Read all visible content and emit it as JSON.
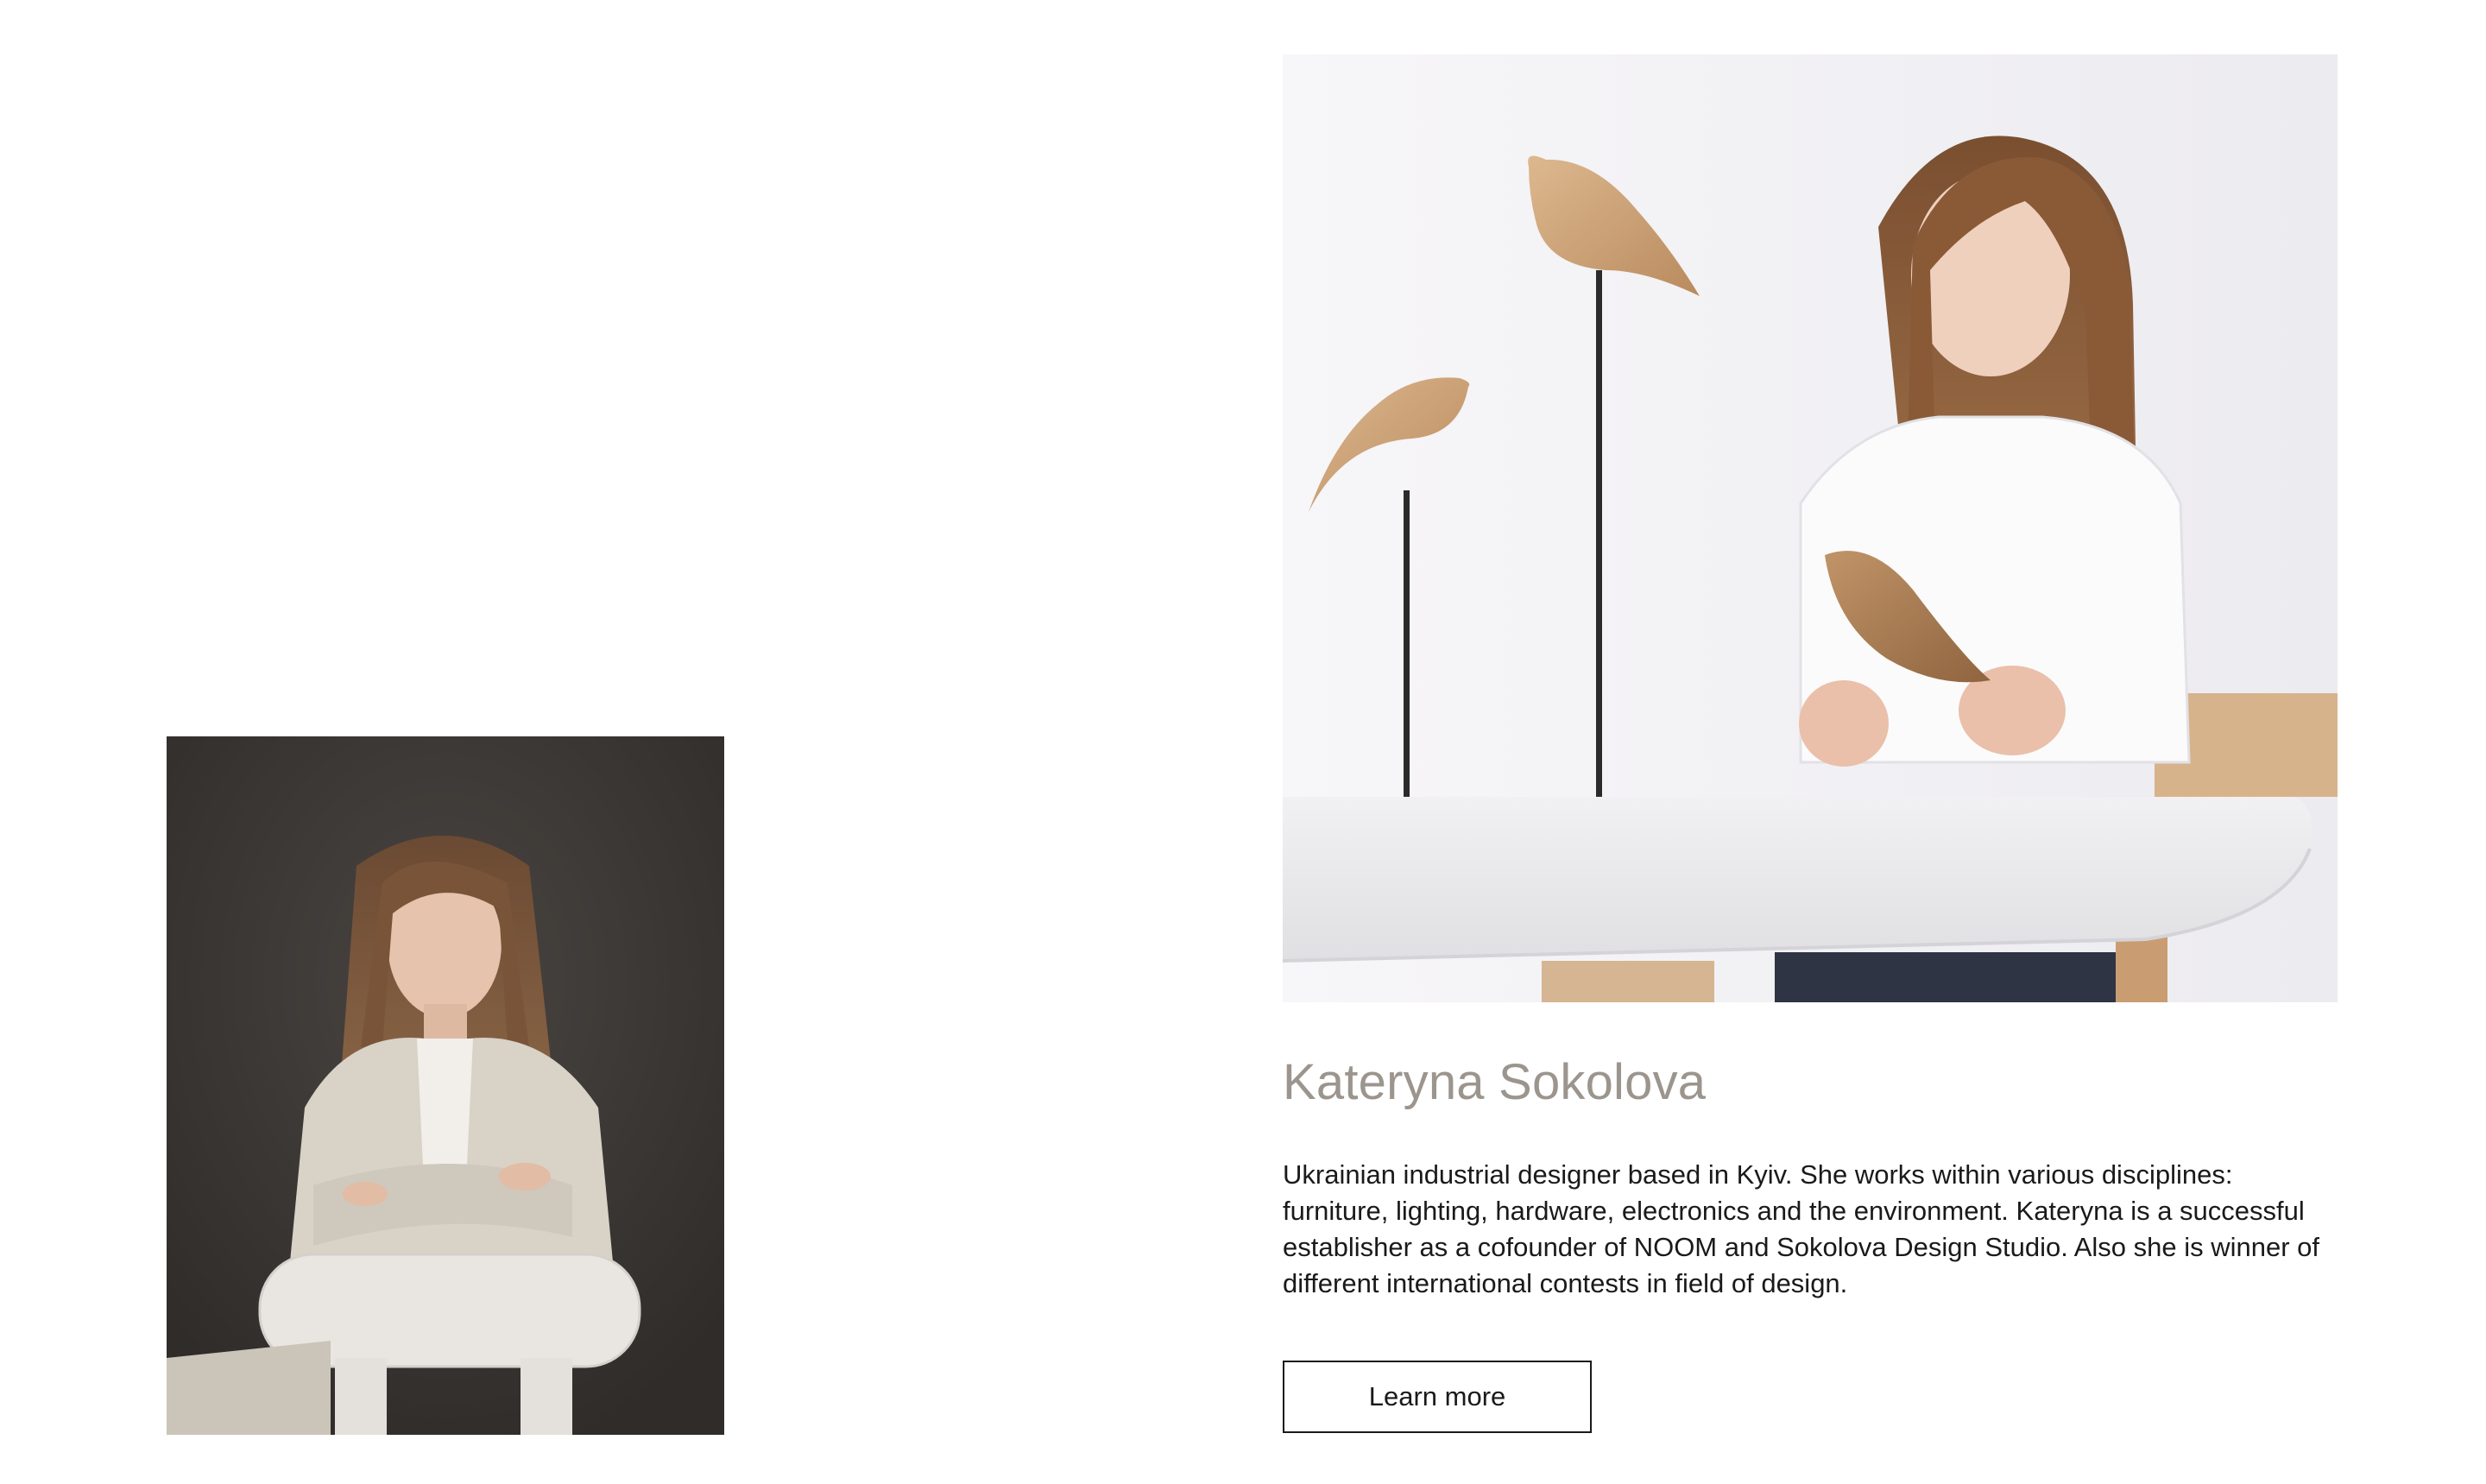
{
  "designer": {
    "name": "Kateryna Sokolova",
    "bio": "Ukrainian industrial designer based in Kyiv. She works within various disciplines: furniture, lighting, hardware, electronics and the environment. Kateryna is a successful establisher as a cofounder of NOOM and Sokolova Design Studio. Also she is winner of different international contests in field of design.",
    "cta_label": "Learn more"
  },
  "colors": {
    "name_text": "#9b958e",
    "body_text": "#1a1a1a",
    "button_border": "#1a1a1a",
    "portrait_bg": "#3c3936",
    "studio_bg": "#f4f3f6"
  }
}
